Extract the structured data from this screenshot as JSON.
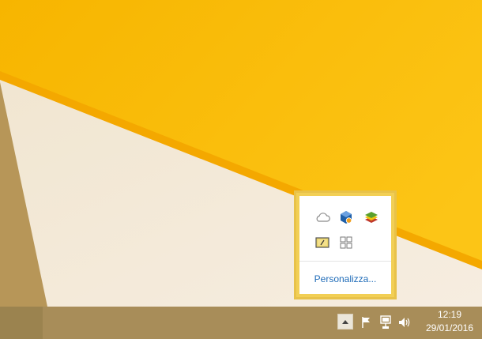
{
  "desktop": {
    "colors": {
      "yellow": "#f8b800",
      "light_yellow": "#fcc80e",
      "wedge": "#f2e9d8",
      "beam": "#f3a700"
    }
  },
  "tray_popup": {
    "icons": [
      "onedrive-icon",
      "virtualbox-icon",
      "bluestacks-icon",
      "battery-monitor-icon",
      "windows-icon"
    ],
    "personalize_label": "Personalizza..."
  },
  "taskbar": {
    "tray_icons": [
      "show-hidden-icons-arrow",
      "action-center-flag-icon",
      "network-icon",
      "volume-icon"
    ],
    "clock": {
      "time": "12:19",
      "date": "29/01/2016"
    },
    "colors": {
      "background": "#a88d59",
      "text": "#ffffff"
    }
  }
}
